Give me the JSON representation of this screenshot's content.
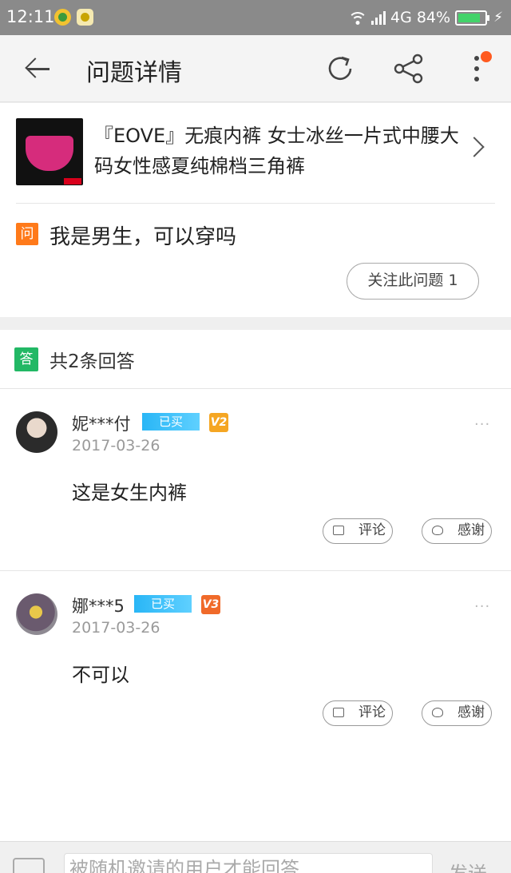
{
  "status_bar": {
    "time": "12:11",
    "network": "4G",
    "battery": "84%",
    "battery_level": 0.84
  },
  "header": {
    "title": "问题详情"
  },
  "product": {
    "title": "『EOVE』无痕内裤 女士冰丝一片式中腰大码女性感夏纯棉档三角裤"
  },
  "question": {
    "badge": "问",
    "text": "我是男生，可以穿吗",
    "follow_label": "关注此问题 1"
  },
  "answers_section": {
    "badge": "答",
    "count_label": "共2条回答"
  },
  "answers": [
    {
      "user": "妮***付",
      "bought_label": "已买",
      "level": "V2",
      "date": "2017-03-26",
      "text": "这是女生内裤",
      "more": "···",
      "comment_label": "评论",
      "thanks_label": "感谢"
    },
    {
      "user": "娜***5",
      "bought_label": "已买",
      "level": "V3",
      "date": "2017-03-26",
      "text": "不可以",
      "more": "···",
      "comment_label": "评论",
      "thanks_label": "感谢"
    }
  ],
  "bottom_bar": {
    "placeholder": "被随机邀请的用户才能回答",
    "send_label": "发送"
  },
  "icons": {
    "back": "arrow-left-icon",
    "refresh": "refresh-icon",
    "share": "share-icon",
    "more": "more-vertical-icon"
  },
  "colors": {
    "question_badge": "#ff7a1a",
    "answer_badge": "#22b865",
    "bought_badge": "#29b6f6",
    "notification_dot": "#ff5a1f"
  }
}
